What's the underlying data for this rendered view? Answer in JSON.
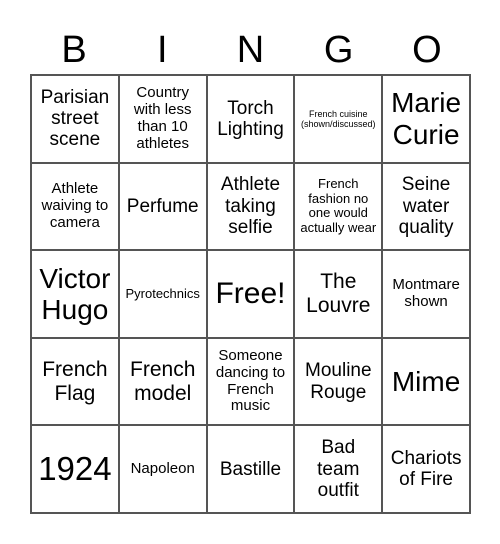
{
  "header": [
    "B",
    "I",
    "N",
    "G",
    "O"
  ],
  "cells": [
    {
      "text": "Parisian street scene",
      "size": "s-lg",
      "lines": [
        "Parisian",
        "street",
        "scene"
      ]
    },
    {
      "text": "Country with less than 10 athletes",
      "size": "s-md",
      "lines": [
        "Country",
        "with less",
        "than 10",
        "athletes"
      ]
    },
    {
      "text": "Torch Lighting",
      "size": "s-lg",
      "lines": [
        "Torch",
        "Lighting"
      ]
    },
    {
      "text": "French cuisine (shown/discussed)",
      "size": "s-xs",
      "lines": [
        "French cuisine",
        "(shown/discussed)"
      ]
    },
    {
      "text": "Marie Curie",
      "size": "s-xxl",
      "lines": [
        "Marie",
        "Curie"
      ]
    },
    {
      "text": "Athlete waiving to camera",
      "size": "s-md",
      "lines": [
        "Athlete",
        "waiving to",
        "camera"
      ]
    },
    {
      "text": "Perfume",
      "size": "s-lg",
      "lines": [
        "Perfume"
      ]
    },
    {
      "text": "Athlete taking selfie",
      "size": "s-lg",
      "lines": [
        "Athlete",
        "taking",
        "selfie"
      ]
    },
    {
      "text": "French fashion no one would actually wear",
      "size": "s-sm",
      "lines": [
        "French",
        "fashion no",
        "one would",
        "actually wear"
      ]
    },
    {
      "text": "Seine water quality",
      "size": "s-lg",
      "lines": [
        "Seine",
        "water",
        "quality"
      ]
    },
    {
      "text": "Victor Hugo",
      "size": "s-xxl",
      "lines": [
        "Victor",
        "Hugo"
      ]
    },
    {
      "text": "Pyrotechnics",
      "size": "s-sm",
      "lines": [
        "Pyrotechnics"
      ]
    },
    {
      "text": "Free!",
      "size": "s-free",
      "lines": [
        "Free!"
      ]
    },
    {
      "text": "The Louvre",
      "size": "s-xl",
      "lines": [
        "The",
        "Louvre"
      ]
    },
    {
      "text": "Montmare shown",
      "size": "s-md",
      "lines": [
        "Montmare",
        "shown"
      ]
    },
    {
      "text": "French Flag",
      "size": "s-xl",
      "lines": [
        "French",
        "Flag"
      ]
    },
    {
      "text": "French model",
      "size": "s-xl",
      "lines": [
        "French",
        "model"
      ]
    },
    {
      "text": "Someone dancing to French music",
      "size": "s-md",
      "lines": [
        "Someone",
        "dancing to",
        "French",
        "music"
      ]
    },
    {
      "text": "Mouline Rouge",
      "size": "s-lg",
      "lines": [
        "Mouline",
        "Rouge"
      ]
    },
    {
      "text": "Mime",
      "size": "s-xxl",
      "lines": [
        "Mime"
      ]
    },
    {
      "text": "1924",
      "size": "s-huge",
      "lines": [
        "1924"
      ]
    },
    {
      "text": "Napoleon",
      "size": "s-md",
      "lines": [
        "Napoleon"
      ]
    },
    {
      "text": "Bastille",
      "size": "s-lg",
      "lines": [
        "Bastille"
      ]
    },
    {
      "text": "Bad team outfit",
      "size": "s-lg",
      "lines": [
        "Bad",
        "team",
        "outfit"
      ]
    },
    {
      "text": "Chariots of Fire",
      "size": "s-lg",
      "lines": [
        "Chariots",
        "of Fire"
      ]
    }
  ]
}
